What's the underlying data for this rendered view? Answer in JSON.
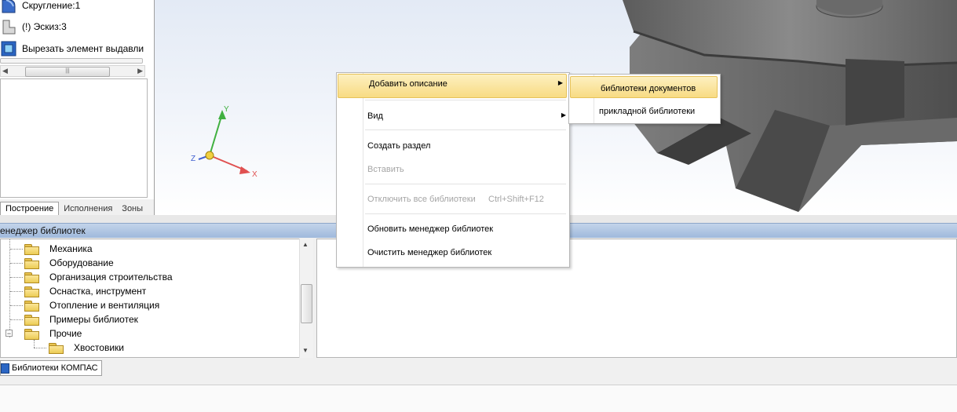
{
  "tree": {
    "items": [
      {
        "label": "Скругление:1",
        "icon": "fillet-icon"
      },
      {
        "label": "(!) Эскиз:3",
        "icon": "sketch-icon"
      },
      {
        "label": "Вырезать элемент выдавли",
        "icon": "cut-extrude-icon"
      }
    ],
    "tabs": [
      "Построение",
      "Исполнения",
      "Зоны"
    ]
  },
  "viewport": {
    "axes": {
      "x": "X",
      "y": "Y",
      "z": "Z"
    },
    "colors": {
      "x": "#e05050",
      "y": "#40b040",
      "z": "#4060d0",
      "model": "#6e6e6e"
    }
  },
  "library_manager": {
    "title": "енеджер библиотек",
    "items": [
      {
        "label": "Механика"
      },
      {
        "label": "Оборудование"
      },
      {
        "label": "Организация строительства"
      },
      {
        "label": "Оснастка, инструмент"
      },
      {
        "label": "Отопление и вентиляция"
      },
      {
        "label": "Примеры библиотек"
      },
      {
        "label": "Прочие",
        "expanded": true
      },
      {
        "label": "Хвостовики",
        "child": true
      }
    ],
    "tab": "Библиотеки КОМПАС"
  },
  "context_menu": {
    "items": [
      {
        "label": "Добавить описание",
        "has_submenu": true,
        "highlighted": true
      },
      {
        "label": "Вид",
        "has_submenu": true
      },
      {
        "label": "Создать раздел"
      },
      {
        "label": "Вставить",
        "disabled": true
      },
      {
        "label": "Отключить все библиотеки",
        "shortcut": "Ctrl+Shift+F12",
        "disabled": true
      },
      {
        "label": "Обновить менеджер библиотек"
      },
      {
        "label": "Очистить менеджер библиотек"
      }
    ],
    "submenu": [
      {
        "label": "библиотеки документов",
        "highlighted": true
      },
      {
        "label": "прикладной библиотеки"
      }
    ]
  },
  "colors": {
    "highlight": "#f8db83",
    "header": "#a9c0e0"
  }
}
